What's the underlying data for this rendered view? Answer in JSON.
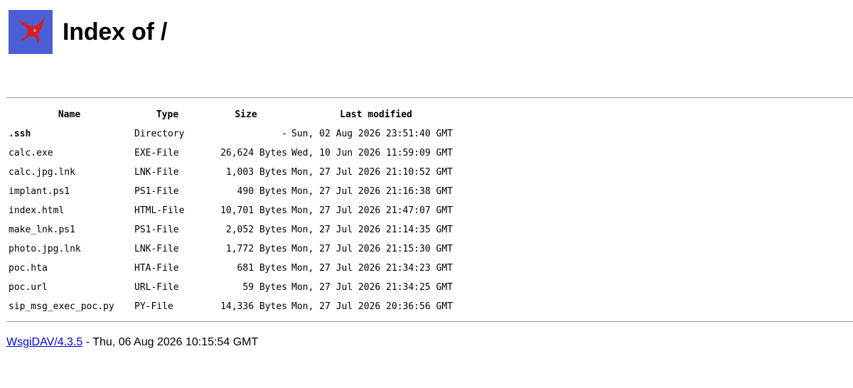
{
  "page": {
    "title": "Index of /"
  },
  "table": {
    "headers": [
      "Name",
      "Type",
      "Size",
      "Last modified"
    ],
    "rows": [
      {
        "name": ".ssh",
        "type": "Directory",
        "size": "-",
        "modified": "Sun, 02 Aug 2026 23:51:40 GMT"
      },
      {
        "name": "calc.exe",
        "type": "EXE-File",
        "size": "26,624 Bytes",
        "modified": "Wed, 10 Jun 2026 11:59:09 GMT"
      },
      {
        "name": "calc.jpg.lnk",
        "type": "LNK-File",
        "size": "1,003 Bytes",
        "modified": "Mon, 27 Jul 2026 21:10:52 GMT"
      },
      {
        "name": "implant.ps1",
        "type": "PS1-File",
        "size": "490 Bytes",
        "modified": "Mon, 27 Jul 2026 21:16:38 GMT"
      },
      {
        "name": "index.html",
        "type": "HTML-File",
        "size": "10,701 Bytes",
        "modified": "Mon, 27 Jul 2026 21:47:07 GMT"
      },
      {
        "name": "make_lnk.ps1",
        "type": "PS1-File",
        "size": "2,052 Bytes",
        "modified": "Mon, 27 Jul 2026 21:14:35 GMT"
      },
      {
        "name": "photo.jpg.lnk",
        "type": "LNK-File",
        "size": "1,772 Bytes",
        "modified": "Mon, 27 Jul 2026 21:15:30 GMT"
      },
      {
        "name": "poc.hta",
        "type": "HTA-File",
        "size": "681 Bytes",
        "modified": "Mon, 27 Jul 2026 21:34:23 GMT"
      },
      {
        "name": "poc.url",
        "type": "URL-File",
        "size": "59 Bytes",
        "modified": "Mon, 27 Jul 2026 21:34:25 GMT"
      },
      {
        "name": "sip_msg_exec_poc.py",
        "type": "PY-File",
        "size": "14,336 Bytes",
        "modified": "Mon, 27 Jul 2026 20:36:56 GMT"
      }
    ]
  },
  "footer": {
    "link_text": "WsgiDAV/4.3.5",
    "suffix": " - Thu, 06 Aug 2026 10:15:54 GMT"
  },
  "colors": {
    "logo_bg": "#4a5fd6",
    "logo_bird": "#d81e22",
    "link": "#0000ee",
    "rule": "#999999"
  },
  "icons": {
    "logo": "red-bird-logo-icon"
  }
}
